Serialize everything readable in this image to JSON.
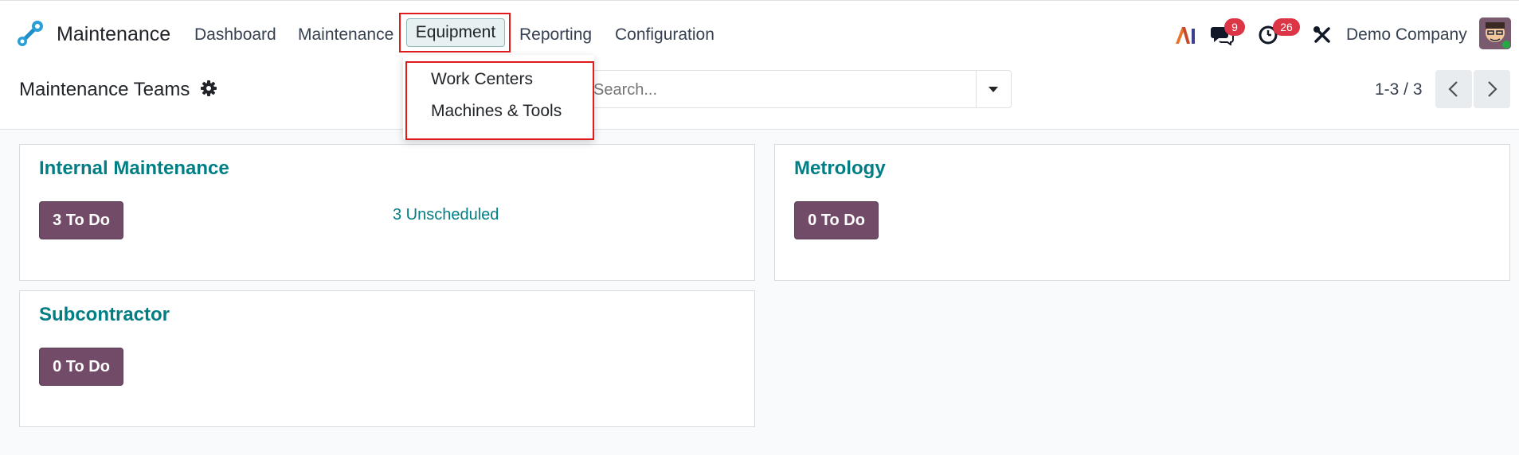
{
  "navbar": {
    "app_name": "Maintenance",
    "menu": [
      "Dashboard",
      "Maintenance",
      "Equipment",
      "Reporting",
      "Configuration"
    ],
    "messages_count": "9",
    "activities_count": "26",
    "company": "Demo Company"
  },
  "equipment_menu": {
    "items": [
      "Work Centers",
      "Machines & Tools"
    ]
  },
  "control_panel": {
    "title": "Maintenance Teams",
    "search_placeholder": "Search...",
    "pager": "1-3 / 3"
  },
  "teams": [
    {
      "name": "Internal Maintenance",
      "todo": "3 To Do",
      "unscheduled": "3 Unscheduled"
    },
    {
      "name": "Metrology",
      "todo": "0 To Do"
    },
    {
      "name": "Subcontractor",
      "todo": "0 To Do"
    }
  ],
  "colors": {
    "brand": "#714b67",
    "link": "#017e84",
    "highlight": "#e01b1b",
    "badge": "#dc3545"
  }
}
